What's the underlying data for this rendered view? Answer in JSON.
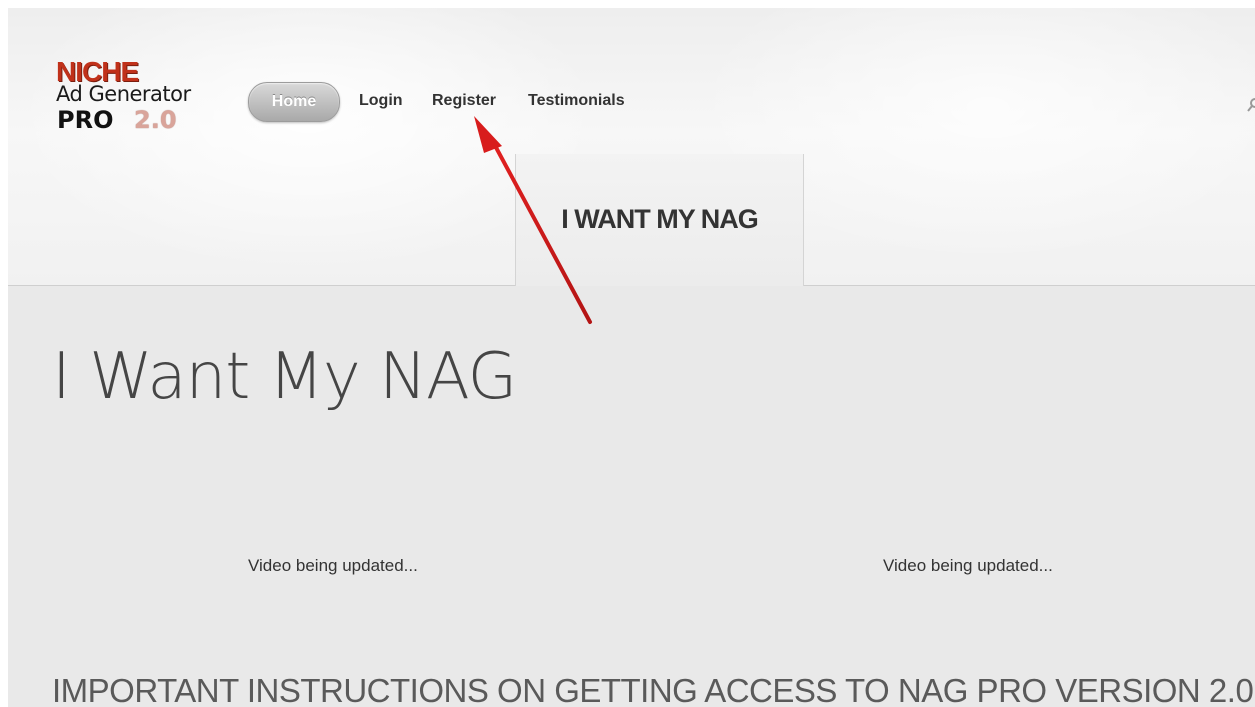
{
  "logo": {
    "line1": "NICHE",
    "line2": "Ad Generator",
    "line3a": "PRO",
    "line3b": "2.0"
  },
  "nav": {
    "items": [
      {
        "label": "Home",
        "active": true
      },
      {
        "label": "Login",
        "active": false
      },
      {
        "label": "Register",
        "active": false
      },
      {
        "label": "Testimonials",
        "active": false
      }
    ]
  },
  "tab_panel": {
    "title": "I WANT MY NAG"
  },
  "main": {
    "page_title": "I Want My NAG",
    "video_left": "Video being updated...",
    "video_right": "Video being updated...",
    "instructions_heading": "IMPORTANT INSTRUCTIONS ON GETTING ACCESS TO NAG PRO VERSION 2.0:"
  },
  "annotation": {
    "arrow_color": "#d81c1c",
    "points_to": "Register"
  },
  "colors": {
    "logo_red": "#c0311a",
    "home_button": "#a9a9a9"
  }
}
